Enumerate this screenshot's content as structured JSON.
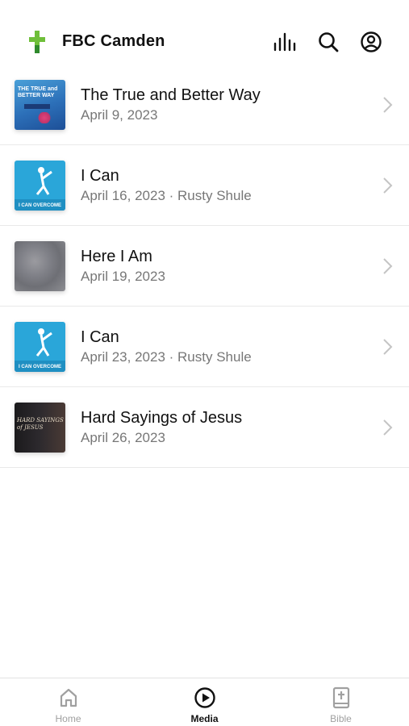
{
  "header": {
    "title": "FBC Camden",
    "logo_color": "#6fbf3a",
    "icons": [
      "audio-bars-icon",
      "search-icon",
      "account-icon"
    ]
  },
  "media_list": [
    {
      "title": "The True and Better Way",
      "subtitle": "April 9, 2023",
      "thumb_text": "THE TRUE and BETTER WAY"
    },
    {
      "title": "I Can",
      "subtitle": "April 16, 2023 · Rusty Shule",
      "thumb_text": "I CAN OVERCOME"
    },
    {
      "title": "Here I Am",
      "subtitle": "April 19, 2023"
    },
    {
      "title": "I Can",
      "subtitle": "April 23, 2023 · Rusty Shule",
      "thumb_text": "I CAN OVERCOME"
    },
    {
      "title": "Hard Sayings of Jesus",
      "subtitle": "April 26, 2023",
      "thumb_text": "HARD SAYINGS of JESUS"
    }
  ],
  "tabs": [
    {
      "label": "Home",
      "icon": "home-icon",
      "active": false
    },
    {
      "label": "Media",
      "icon": "play-circle-icon",
      "active": true
    },
    {
      "label": "Bible",
      "icon": "bible-icon",
      "active": false
    }
  ],
  "colors": {
    "active_tab": "#111111",
    "inactive_tab": "#a0a0a0",
    "subtitle": "#777777"
  }
}
